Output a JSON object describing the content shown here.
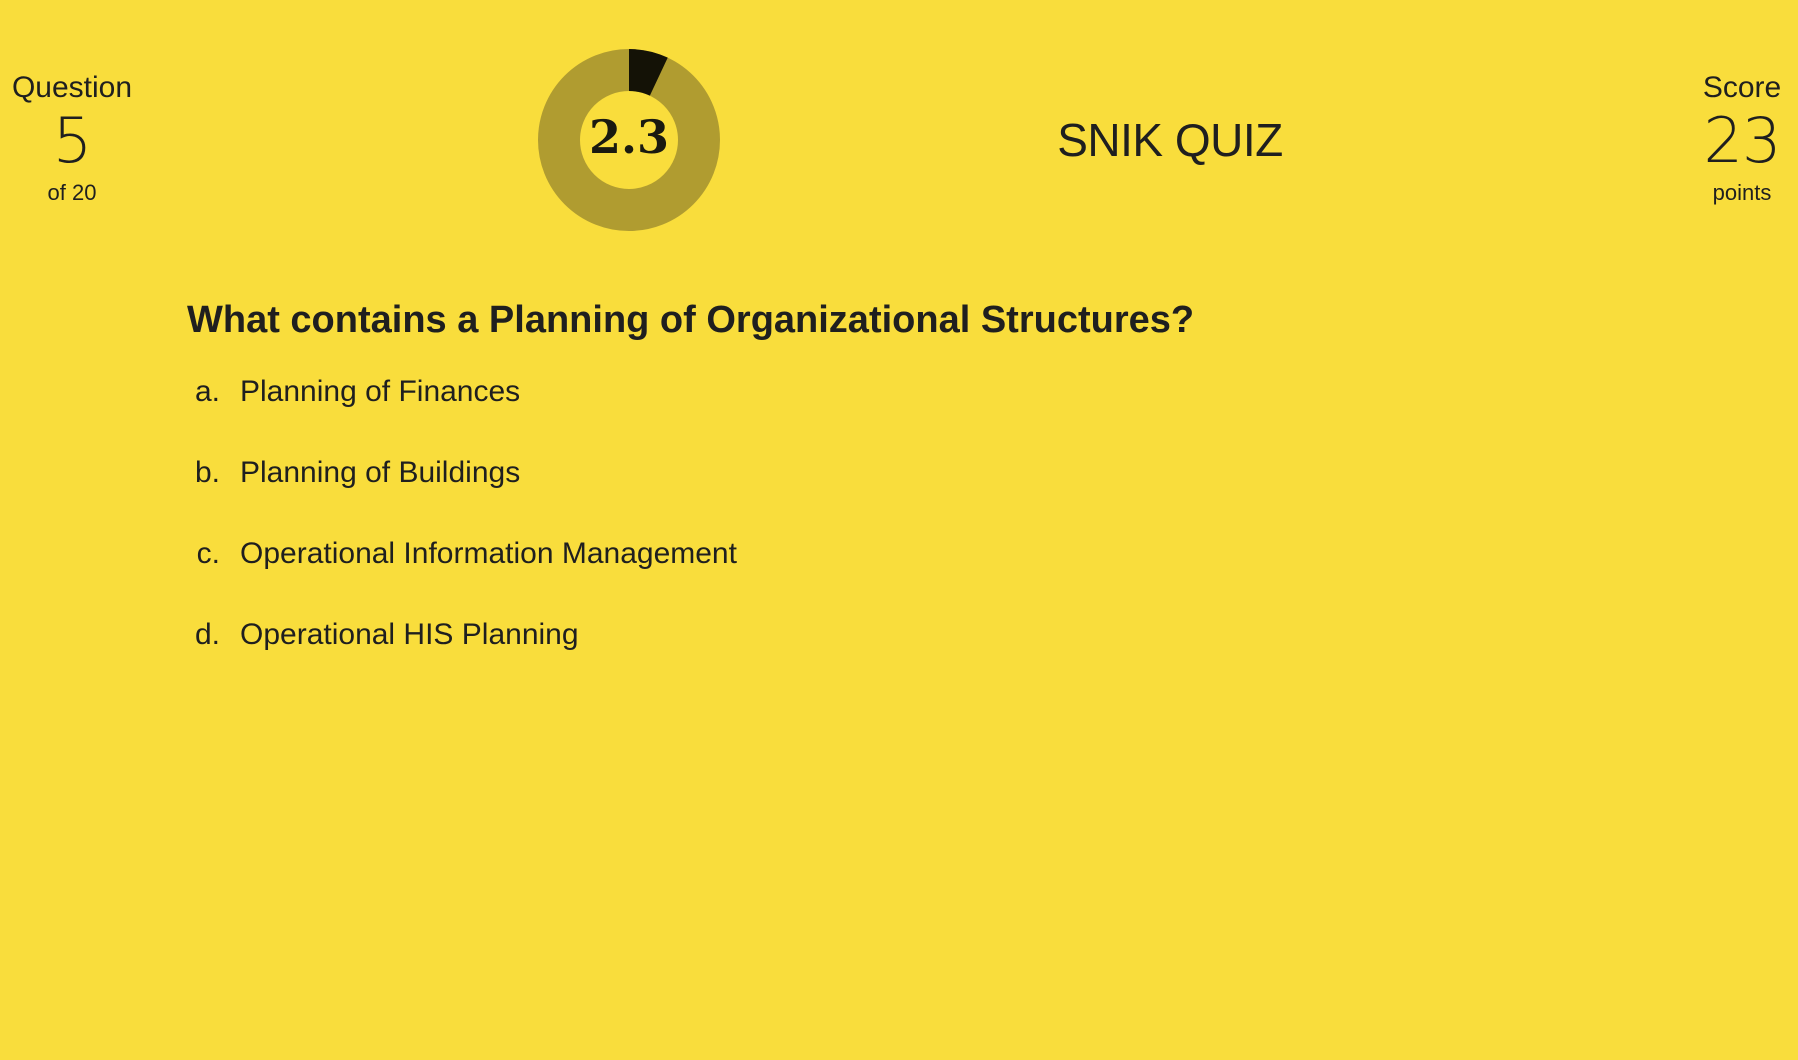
{
  "app": {
    "title": "SNIK QUIZ"
  },
  "question_counter": {
    "label": "Question",
    "current": "5",
    "total_text": "of 20"
  },
  "score": {
    "label": "Score",
    "value": "23",
    "unit": "points"
  },
  "timer": {
    "value": "2.3",
    "elapsed_fraction": 0.07,
    "colors": {
      "ring": "#b09c30",
      "elapsed": "#141206"
    }
  },
  "question": {
    "text": "What contains a Planning of Organizational Structures?",
    "answers": [
      {
        "letter": "a.",
        "text": "Planning of Finances"
      },
      {
        "letter": "b.",
        "text": "Planning of Buildings"
      },
      {
        "letter": "c.",
        "text": "Operational Information Management"
      },
      {
        "letter": "d.",
        "text": "Operational HIS Planning"
      }
    ]
  },
  "colors": {
    "background": "#f9dd3c",
    "text": "#1f1f1f"
  }
}
